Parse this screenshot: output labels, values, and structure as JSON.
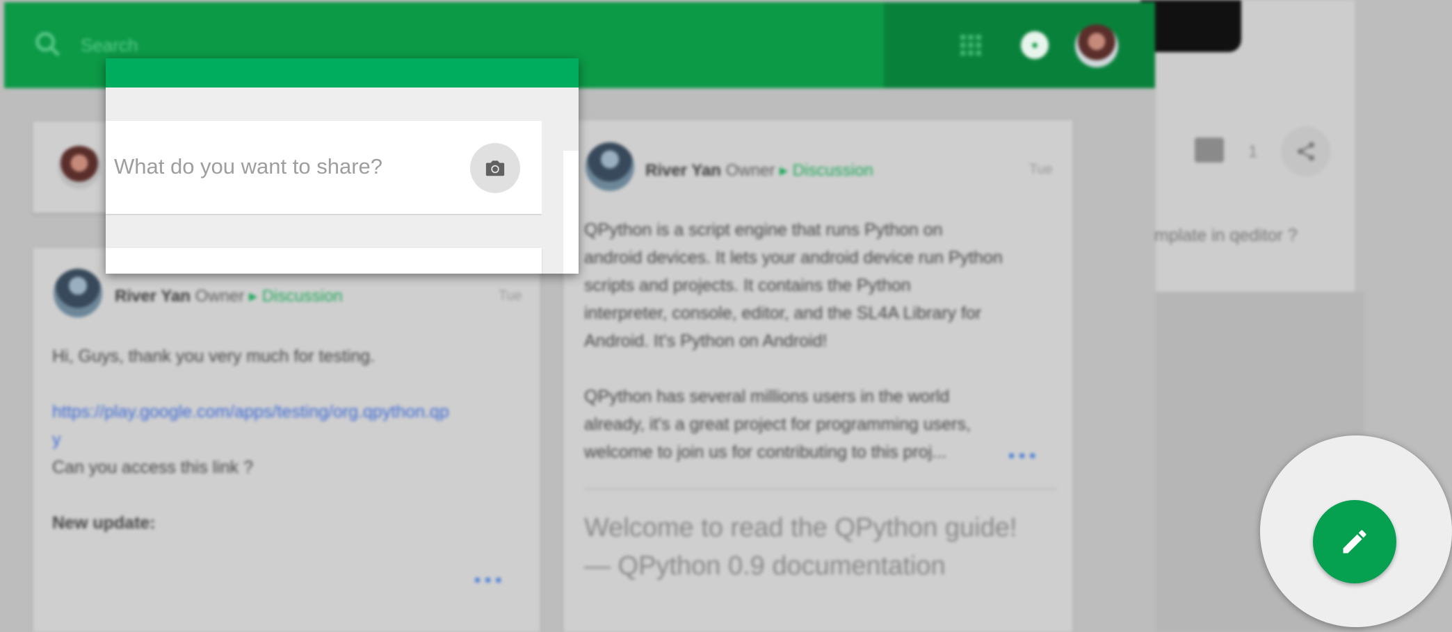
{
  "search": {
    "placeholder": "Search"
  },
  "share_box": {
    "placeholder": "What do you want to share?"
  },
  "post_left": {
    "author": "River Yan",
    "role": "Owner",
    "category": "Discussion",
    "time": "Tue",
    "line1": "Hi, Guys, thank you very much for testing.",
    "link_line1": "https://play.google.com/apps/testing/org.qpython.qp",
    "link_line2": "y",
    "line2": "Can you access this link ?",
    "line3": "New update:"
  },
  "post_right": {
    "author": "River Yan",
    "role": "Owner",
    "category": "Discussion",
    "time": "Tue",
    "para1_line1": "QPython is a script engine that runs Python on",
    "para1_line2": "android devices. It lets your android device run Python",
    "para1_line3": "scripts and projects. It contains the Python",
    "para1_line4": "interpreter, console, editor, and the SL4A Library for",
    "para1_line5": "Android. It's Python on Android!",
    "para2_line1": "QPython has several millions users in the world",
    "para2_line2": "already, it's a great project for programming users,",
    "para2_line3": "welcome to join us for contributing to this proj...",
    "link_title_line1": "Welcome to read the QPython guide!",
    "link_title_line2": "— QPython 0.9 documentation"
  },
  "right_panel": {
    "comment_count": "1",
    "fragment": "mplate in qeditor ?"
  },
  "colors": {
    "brand_green": "#0c9a47",
    "popup_bar": "#00ad5f",
    "fab_green": "#05a150",
    "discussion_green": "#1fa85a",
    "link_blue": "#3d6ad6"
  },
  "icons": {
    "search": "search-icon",
    "apps": "apps-grid-icon",
    "notifications": "notifications-icon",
    "camera": "camera-icon",
    "comment": "comment-icon",
    "share": "share-icon",
    "fab": "pencil-icon"
  }
}
